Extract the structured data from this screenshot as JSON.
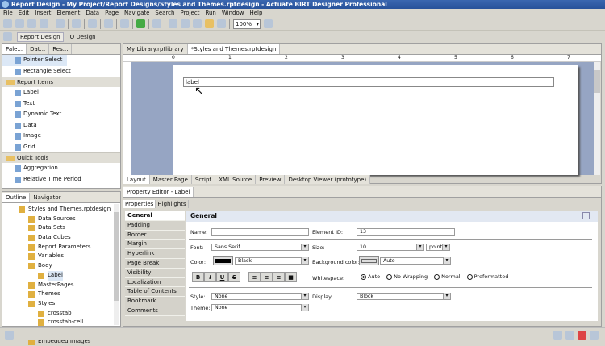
{
  "window": {
    "title": "Report Design - My Project/Report Designs/Styles and Themes.rptdesign - Actuate BIRT Designer Professional"
  },
  "menu": [
    "File",
    "Edit",
    "Insert",
    "Element",
    "Data",
    "Page",
    "Navigate",
    "Search",
    "Project",
    "Run",
    "Window",
    "Help"
  ],
  "toolbar": {
    "zoom": "100%"
  },
  "perspectives": [
    "Report Design",
    "IO Design"
  ],
  "left_tabs": [
    "Pale...",
    "Dat...",
    "Res..."
  ],
  "palette": {
    "tools": [
      "Pointer Select",
      "Rectangle Select"
    ],
    "report_items_header": "Report Items",
    "report_items": [
      "Label",
      "Text",
      "Dynamic Text",
      "Data",
      "Image",
      "Grid"
    ],
    "quick_tools_header": "Quick Tools",
    "quick_tools": [
      "Aggregation",
      "Relative Time Period"
    ]
  },
  "outline_tabs": [
    "Outline",
    "Navigator"
  ],
  "outline": [
    {
      "label": "Styles and Themes.rptdesign",
      "depth": 0
    },
    {
      "label": "Data Sources",
      "depth": 1
    },
    {
      "label": "Data Sets",
      "depth": 1
    },
    {
      "label": "Data Cubes",
      "depth": 1
    },
    {
      "label": "Report Parameters",
      "depth": 1
    },
    {
      "label": "Variables",
      "depth": 1
    },
    {
      "label": "Body",
      "depth": 1
    },
    {
      "label": "Label",
      "depth": 2,
      "selected": true
    },
    {
      "label": "MasterPages",
      "depth": 1
    },
    {
      "label": "Themes",
      "depth": 1
    },
    {
      "label": "Styles",
      "depth": 1
    },
    {
      "label": "crosstab",
      "depth": 2
    },
    {
      "label": "crosstab-cell",
      "depth": 2
    },
    {
      "label": "report",
      "depth": 2
    },
    {
      "label": "Embedded Images",
      "depth": 1
    }
  ],
  "editor": {
    "tabs": [
      "My Library.rptlibrary",
      "*Styles and Themes.rptdesign"
    ],
    "label_text": "label",
    "ruler": [
      "0",
      "1",
      "2",
      "3",
      "4",
      "5",
      "6",
      "7",
      "8"
    ],
    "bottom_tabs": [
      "Layout",
      "Master Page",
      "Script",
      "XML Source",
      "Preview",
      "Desktop Viewer (prototype)"
    ]
  },
  "property_editor": {
    "title": "Property Editor - Label",
    "tabs": [
      "Properties",
      "Highlights"
    ],
    "categories": [
      "General",
      "Padding",
      "Border",
      "Margin",
      "Hyperlink",
      "Page Break",
      "Visibility",
      "Localization",
      "Table of Contents",
      "Bookmark",
      "Comments"
    ],
    "section": "General",
    "name_label": "Name:",
    "name_value": "",
    "element_id_label": "Element ID:",
    "element_id_value": "13",
    "font_label": "Font:",
    "font_value": "Sans Serif",
    "size_label": "Size:",
    "size_value": "10",
    "size_unit": "points",
    "color_label": "Color:",
    "color_value": "Black",
    "color_swatch": "#000000",
    "bg_label": "Background color:",
    "bg_value": "Auto",
    "format_buttons": [
      "B",
      "I",
      "U",
      "S"
    ],
    "whitespace_label": "Whitespace:",
    "whitespace_options": [
      "Auto",
      "No Wrapping",
      "Normal",
      "Preformatted"
    ],
    "whitespace_selected": "Auto",
    "style_label": "Style:",
    "style_value": "None",
    "display_label": "Display:",
    "display_value": "Block",
    "theme_label": "Theme:",
    "theme_value": "None"
  }
}
